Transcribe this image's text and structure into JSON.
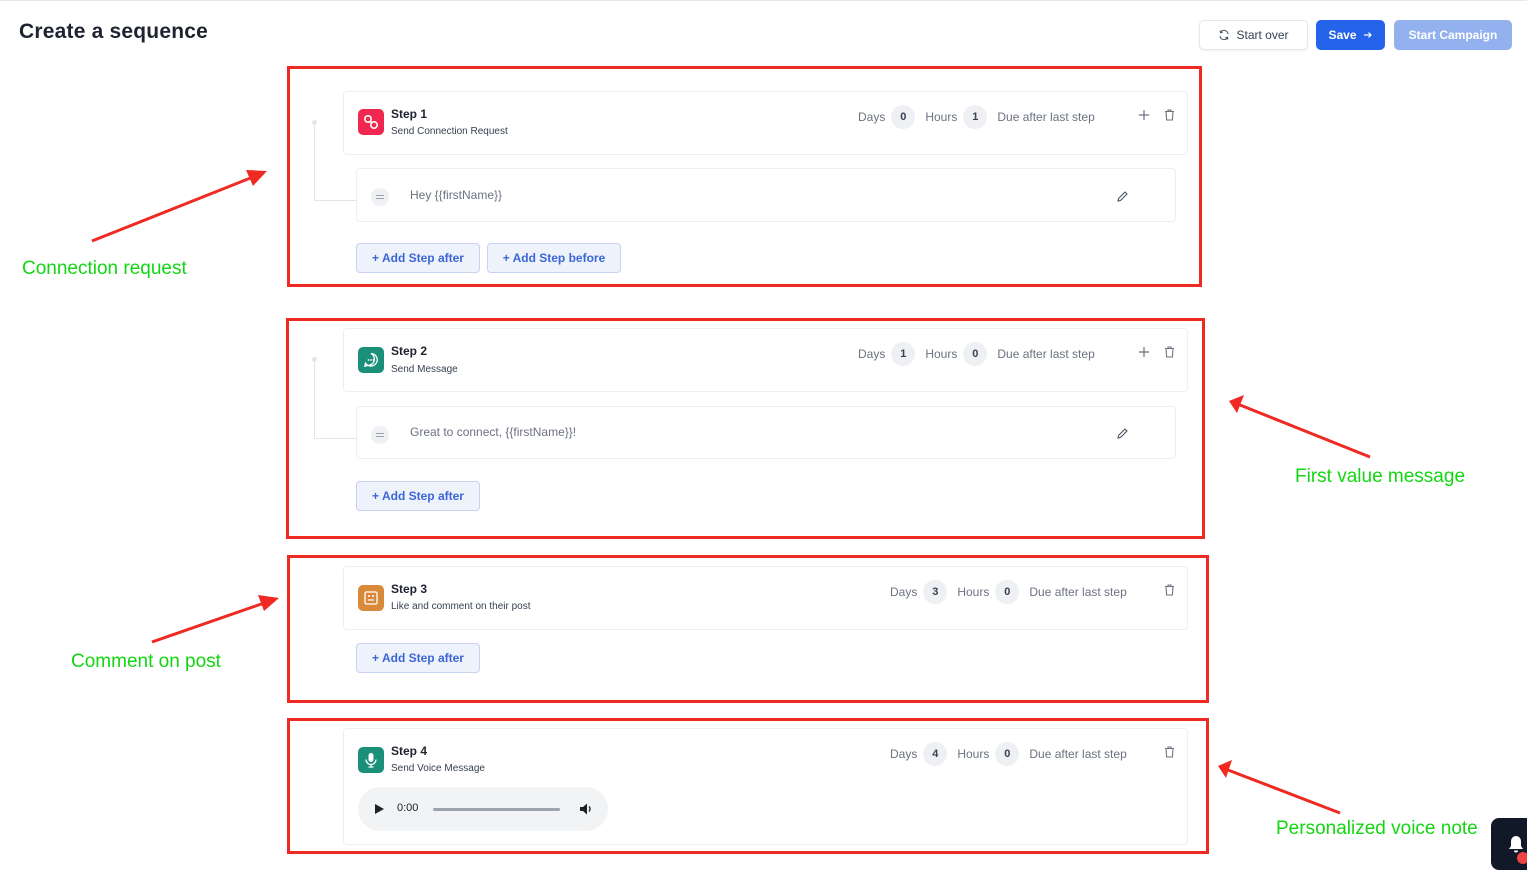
{
  "page": {
    "title": "Create a sequence"
  },
  "toolbar": {
    "start_over_label": "Start over",
    "save_label": "Save",
    "start_campaign_label": "Start Campaign"
  },
  "steps": [
    {
      "title": "Step 1",
      "subtitle": "Send Connection Request",
      "icon": "link-icon",
      "icon_color": "#f0284f",
      "days_label": "Days",
      "days": "0",
      "hours_label": "Hours",
      "hours": "1",
      "due_label": "Due after last step",
      "message": "Hey {{firstName}}",
      "add_after_label": "+ Add Step after",
      "add_before_label": "+ Add Step before"
    },
    {
      "title": "Step 2",
      "subtitle": "Send Message",
      "icon": "chat-icon",
      "icon_color": "#1a8f7a",
      "days_label": "Days",
      "days": "1",
      "hours_label": "Hours",
      "hours": "0",
      "due_label": "Due after last step",
      "message": "Great to connect, {{firstName}}!",
      "add_after_label": "+ Add Step after"
    },
    {
      "title": "Step 3",
      "subtitle": "Like and comment on their post",
      "icon": "post-icon",
      "icon_color": "#d9893a",
      "days_label": "Days",
      "days": "3",
      "hours_label": "Hours",
      "hours": "0",
      "due_label": "Due after last step",
      "add_after_label": "+ Add Step after"
    },
    {
      "title": "Step 4",
      "subtitle": "Send Voice Message",
      "icon": "microphone-icon",
      "icon_color": "#1a8f7a",
      "days_label": "Days",
      "days": "4",
      "hours_label": "Hours",
      "hours": "0",
      "due_label": "Due after last step",
      "audio_time": "0:00"
    }
  ],
  "annotations": {
    "connection_request": "Connection request",
    "first_value_message": "First value message",
    "comment_on_post": "Comment on post",
    "voice_note": "Personalized voice note"
  },
  "colors": {
    "annotation_box": "#ee2a23",
    "annotation_text": "#13d613",
    "primary": "#2563eb"
  }
}
